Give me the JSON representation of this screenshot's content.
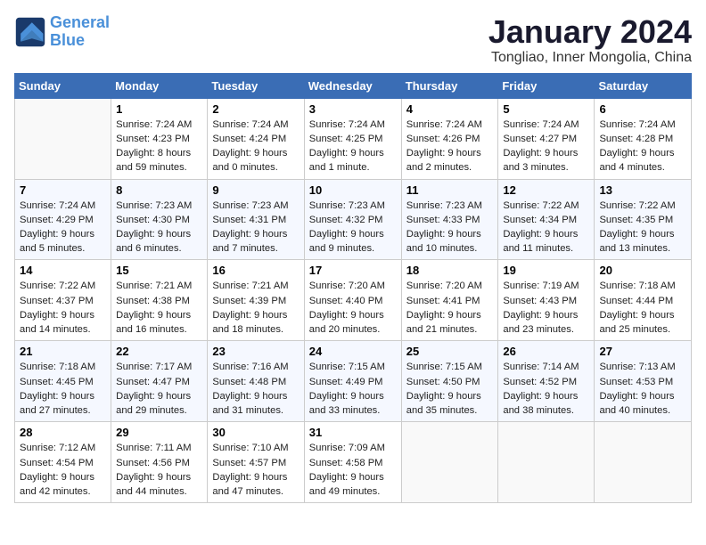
{
  "logo": {
    "line1": "General",
    "line2": "Blue"
  },
  "title": "January 2024",
  "subtitle": "Tongliao, Inner Mongolia, China",
  "weekdays": [
    "Sunday",
    "Monday",
    "Tuesday",
    "Wednesday",
    "Thursday",
    "Friday",
    "Saturday"
  ],
  "weeks": [
    [
      {
        "num": "",
        "info": ""
      },
      {
        "num": "1",
        "info": "Sunrise: 7:24 AM\nSunset: 4:23 PM\nDaylight: 8 hours\nand 59 minutes."
      },
      {
        "num": "2",
        "info": "Sunrise: 7:24 AM\nSunset: 4:24 PM\nDaylight: 9 hours\nand 0 minutes."
      },
      {
        "num": "3",
        "info": "Sunrise: 7:24 AM\nSunset: 4:25 PM\nDaylight: 9 hours\nand 1 minute."
      },
      {
        "num": "4",
        "info": "Sunrise: 7:24 AM\nSunset: 4:26 PM\nDaylight: 9 hours\nand 2 minutes."
      },
      {
        "num": "5",
        "info": "Sunrise: 7:24 AM\nSunset: 4:27 PM\nDaylight: 9 hours\nand 3 minutes."
      },
      {
        "num": "6",
        "info": "Sunrise: 7:24 AM\nSunset: 4:28 PM\nDaylight: 9 hours\nand 4 minutes."
      }
    ],
    [
      {
        "num": "7",
        "info": "Sunrise: 7:24 AM\nSunset: 4:29 PM\nDaylight: 9 hours\nand 5 minutes."
      },
      {
        "num": "8",
        "info": "Sunrise: 7:23 AM\nSunset: 4:30 PM\nDaylight: 9 hours\nand 6 minutes."
      },
      {
        "num": "9",
        "info": "Sunrise: 7:23 AM\nSunset: 4:31 PM\nDaylight: 9 hours\nand 7 minutes."
      },
      {
        "num": "10",
        "info": "Sunrise: 7:23 AM\nSunset: 4:32 PM\nDaylight: 9 hours\nand 9 minutes."
      },
      {
        "num": "11",
        "info": "Sunrise: 7:23 AM\nSunset: 4:33 PM\nDaylight: 9 hours\nand 10 minutes."
      },
      {
        "num": "12",
        "info": "Sunrise: 7:22 AM\nSunset: 4:34 PM\nDaylight: 9 hours\nand 11 minutes."
      },
      {
        "num": "13",
        "info": "Sunrise: 7:22 AM\nSunset: 4:35 PM\nDaylight: 9 hours\nand 13 minutes."
      }
    ],
    [
      {
        "num": "14",
        "info": "Sunrise: 7:22 AM\nSunset: 4:37 PM\nDaylight: 9 hours\nand 14 minutes."
      },
      {
        "num": "15",
        "info": "Sunrise: 7:21 AM\nSunset: 4:38 PM\nDaylight: 9 hours\nand 16 minutes."
      },
      {
        "num": "16",
        "info": "Sunrise: 7:21 AM\nSunset: 4:39 PM\nDaylight: 9 hours\nand 18 minutes."
      },
      {
        "num": "17",
        "info": "Sunrise: 7:20 AM\nSunset: 4:40 PM\nDaylight: 9 hours\nand 20 minutes."
      },
      {
        "num": "18",
        "info": "Sunrise: 7:20 AM\nSunset: 4:41 PM\nDaylight: 9 hours\nand 21 minutes."
      },
      {
        "num": "19",
        "info": "Sunrise: 7:19 AM\nSunset: 4:43 PM\nDaylight: 9 hours\nand 23 minutes."
      },
      {
        "num": "20",
        "info": "Sunrise: 7:18 AM\nSunset: 4:44 PM\nDaylight: 9 hours\nand 25 minutes."
      }
    ],
    [
      {
        "num": "21",
        "info": "Sunrise: 7:18 AM\nSunset: 4:45 PM\nDaylight: 9 hours\nand 27 minutes."
      },
      {
        "num": "22",
        "info": "Sunrise: 7:17 AM\nSunset: 4:47 PM\nDaylight: 9 hours\nand 29 minutes."
      },
      {
        "num": "23",
        "info": "Sunrise: 7:16 AM\nSunset: 4:48 PM\nDaylight: 9 hours\nand 31 minutes."
      },
      {
        "num": "24",
        "info": "Sunrise: 7:15 AM\nSunset: 4:49 PM\nDaylight: 9 hours\nand 33 minutes."
      },
      {
        "num": "25",
        "info": "Sunrise: 7:15 AM\nSunset: 4:50 PM\nDaylight: 9 hours\nand 35 minutes."
      },
      {
        "num": "26",
        "info": "Sunrise: 7:14 AM\nSunset: 4:52 PM\nDaylight: 9 hours\nand 38 minutes."
      },
      {
        "num": "27",
        "info": "Sunrise: 7:13 AM\nSunset: 4:53 PM\nDaylight: 9 hours\nand 40 minutes."
      }
    ],
    [
      {
        "num": "28",
        "info": "Sunrise: 7:12 AM\nSunset: 4:54 PM\nDaylight: 9 hours\nand 42 minutes."
      },
      {
        "num": "29",
        "info": "Sunrise: 7:11 AM\nSunset: 4:56 PM\nDaylight: 9 hours\nand 44 minutes."
      },
      {
        "num": "30",
        "info": "Sunrise: 7:10 AM\nSunset: 4:57 PM\nDaylight: 9 hours\nand 47 minutes."
      },
      {
        "num": "31",
        "info": "Sunrise: 7:09 AM\nSunset: 4:58 PM\nDaylight: 9 hours\nand 49 minutes."
      },
      {
        "num": "",
        "info": ""
      },
      {
        "num": "",
        "info": ""
      },
      {
        "num": "",
        "info": ""
      }
    ]
  ]
}
